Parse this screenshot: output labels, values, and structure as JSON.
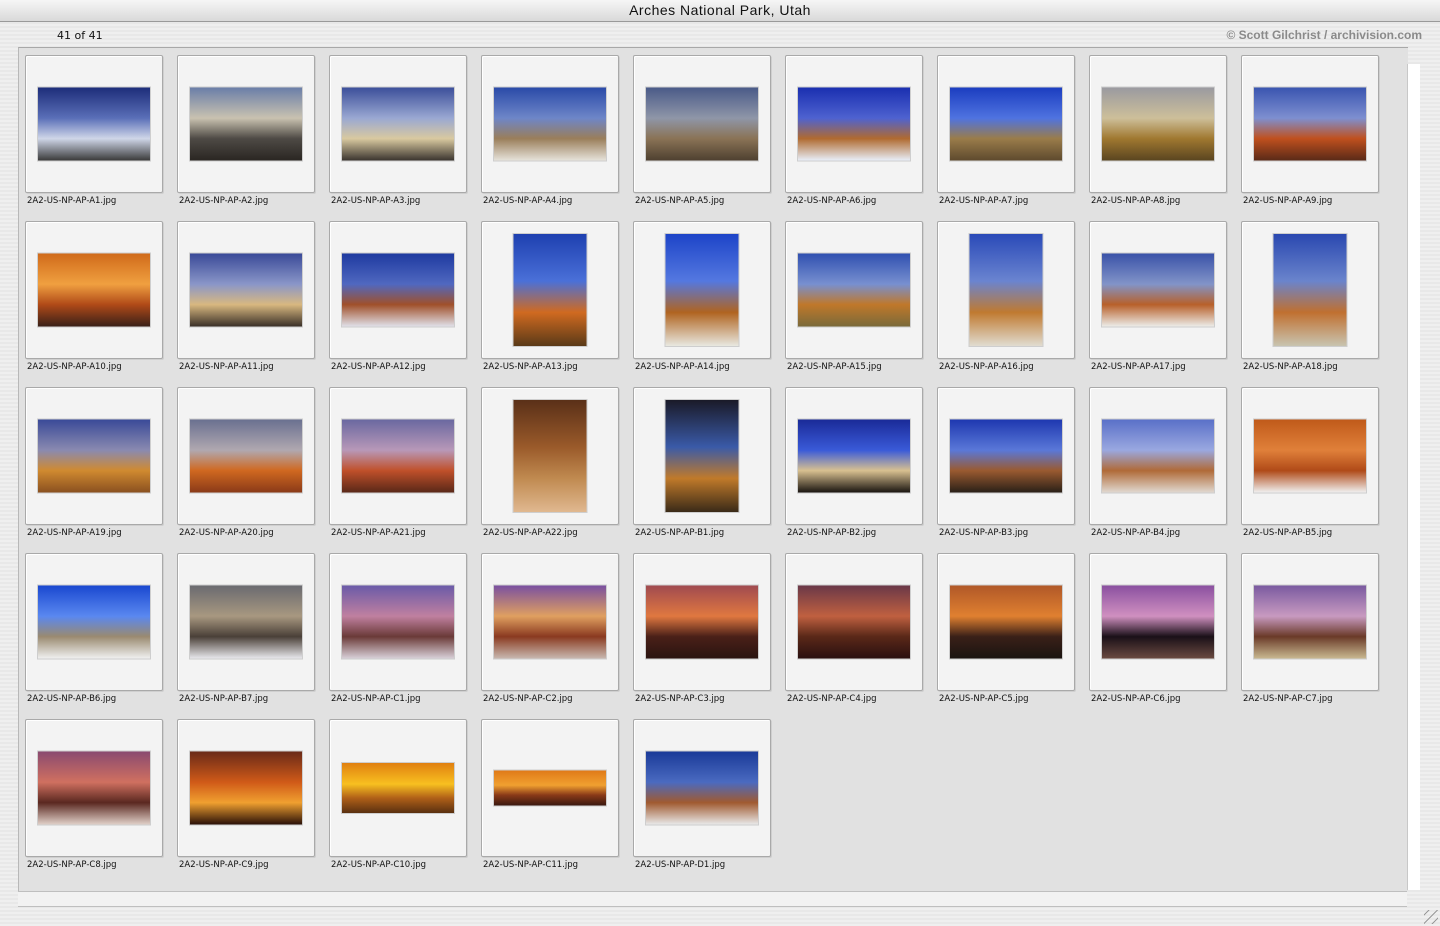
{
  "window": {
    "title": "Arches National Park, Utah",
    "count_label": "41 of 41",
    "copyright": "© Scott Gilchrist / archivision.com"
  },
  "thumbnails": [
    {
      "file": "2A2-US-NP-AP-A1.jpg",
      "orientation": "landscape",
      "palette": [
        "#1d2d7a",
        "#5a6fb8",
        "#cfd6e8",
        "#3a3a3a"
      ]
    },
    {
      "file": "2A2-US-NP-AP-A2.jpg",
      "orientation": "landscape",
      "palette": [
        "#6a7ea8",
        "#c9c2b0",
        "#4e4a45",
        "#2a2622"
      ]
    },
    {
      "file": "2A2-US-NP-AP-A3.jpg",
      "orientation": "landscape",
      "palette": [
        "#3c4f9a",
        "#9aa8d2",
        "#d9c9a0",
        "#3a342f"
      ]
    },
    {
      "file": "2A2-US-NP-AP-A4.jpg",
      "orientation": "landscape",
      "palette": [
        "#2a4aa8",
        "#6e86c8",
        "#9a7e5a",
        "#e6e2da"
      ]
    },
    {
      "file": "2A2-US-NP-AP-A5.jpg",
      "orientation": "landscape",
      "palette": [
        "#4a5a88",
        "#8f96a8",
        "#8a7356",
        "#4e4030"
      ]
    },
    {
      "file": "2A2-US-NP-AP-A6.jpg",
      "orientation": "landscape",
      "palette": [
        "#1a2fb0",
        "#4e62d0",
        "#b06a30",
        "#e8eef8"
      ]
    },
    {
      "file": "2A2-US-NP-AP-A7.jpg",
      "orientation": "landscape",
      "palette": [
        "#1b3dc0",
        "#4f73e0",
        "#9a7c4a",
        "#5e4a2e"
      ]
    },
    {
      "file": "2A2-US-NP-AP-A8.jpg",
      "orientation": "landscape",
      "palette": [
        "#9a9aa0",
        "#cdbf9a",
        "#a07830",
        "#5a4520"
      ]
    },
    {
      "file": "2A2-US-NP-AP-A9.jpg",
      "orientation": "landscape",
      "palette": [
        "#3a55b0",
        "#7e8fd0",
        "#c0501e",
        "#5a2a18"
      ]
    },
    {
      "file": "2A2-US-NP-AP-A10.jpg",
      "orientation": "landscape",
      "palette": [
        "#d06a1a",
        "#f0a040",
        "#b04a18",
        "#3a2018"
      ]
    },
    {
      "file": "2A2-US-NP-AP-A11.jpg",
      "orientation": "landscape",
      "palette": [
        "#3a4a98",
        "#8a96c8",
        "#d8b880",
        "#3a3028"
      ]
    },
    {
      "file": "2A2-US-NP-AP-A12.jpg",
      "orientation": "landscape",
      "palette": [
        "#1e3aa0",
        "#5068c0",
        "#a0502a",
        "#e0e0e8"
      ]
    },
    {
      "file": "2A2-US-NP-AP-A13.jpg",
      "orientation": "portrait",
      "palette": [
        "#1e40b0",
        "#4a70d8",
        "#d06a20",
        "#5a3a18"
      ]
    },
    {
      "file": "2A2-US-NP-AP-A14.jpg",
      "orientation": "portrait",
      "palette": [
        "#1d44c8",
        "#5478e0",
        "#b06420",
        "#e8e8e0"
      ]
    },
    {
      "file": "2A2-US-NP-AP-A15.jpg",
      "orientation": "landscape",
      "palette": [
        "#3050b0",
        "#7890d0",
        "#c0782a",
        "#7a6a3a"
      ]
    },
    {
      "file": "2A2-US-NP-AP-A16.jpg",
      "orientation": "portrait",
      "palette": [
        "#2a4ab8",
        "#6a84d0",
        "#c07a30",
        "#e0dcd0"
      ]
    },
    {
      "file": "2A2-US-NP-AP-A17.jpg",
      "orientation": "landscape",
      "palette": [
        "#3a52a8",
        "#8294c8",
        "#b8602a",
        "#ecece8"
      ]
    },
    {
      "file": "2A2-US-NP-AP-A18.jpg",
      "orientation": "portrait",
      "palette": [
        "#2a48b0",
        "#6a84cc",
        "#c07030",
        "#c8c4b0"
      ]
    },
    {
      "file": "2A2-US-NP-AP-A19.jpg",
      "orientation": "landscape",
      "palette": [
        "#3a4a98",
        "#8a8ab0",
        "#d08a30",
        "#8a5020"
      ]
    },
    {
      "file": "2A2-US-NP-AP-A20.jpg",
      "orientation": "landscape",
      "palette": [
        "#6a7090",
        "#b0a8b0",
        "#d06820",
        "#8a3a18"
      ]
    },
    {
      "file": "2A2-US-NP-AP-A21.jpg",
      "orientation": "landscape",
      "palette": [
        "#6a68a0",
        "#b898b8",
        "#c0502a",
        "#5a2818"
      ]
    },
    {
      "file": "2A2-US-NP-AP-A22.jpg",
      "orientation": "portrait",
      "palette": [
        "#5a3018",
        "#9a5a2a",
        "#c08a50",
        "#e0b890"
      ]
    },
    {
      "file": "2A2-US-NP-AP-B1.jpg",
      "orientation": "portrait",
      "palette": [
        "#1a1a28",
        "#3a5aa8",
        "#c07a2a",
        "#3a2a18"
      ]
    },
    {
      "file": "2A2-US-NP-AP-B2.jpg",
      "orientation": "landscape",
      "palette": [
        "#1a2a98",
        "#3a5ad8",
        "#d8c090",
        "#1a1410"
      ]
    },
    {
      "file": "2A2-US-NP-AP-B3.jpg",
      "orientation": "landscape",
      "palette": [
        "#1e38b0",
        "#5a78d8",
        "#9a5a30",
        "#2a2018"
      ]
    },
    {
      "file": "2A2-US-NP-AP-B4.jpg",
      "orientation": "landscape",
      "palette": [
        "#5a70c8",
        "#9aa8e0",
        "#b06a38",
        "#e0d8d0"
      ]
    },
    {
      "file": "2A2-US-NP-AP-B5.jpg",
      "orientation": "landscape",
      "palette": [
        "#c05a1a",
        "#e0803a",
        "#b04a18",
        "#f0f0f0"
      ]
    },
    {
      "file": "2A2-US-NP-AP-B6.jpg",
      "orientation": "landscape",
      "palette": [
        "#1a48d0",
        "#5a88f0",
        "#9a8a70",
        "#f0f0f0"
      ]
    },
    {
      "file": "2A2-US-NP-AP-B7.jpg",
      "orientation": "landscape",
      "palette": [
        "#6a6a70",
        "#a89880",
        "#4a4038",
        "#e8e8ec"
      ]
    },
    {
      "file": "2A2-US-NP-AP-C1.jpg",
      "orientation": "landscape",
      "palette": [
        "#6a5aa8",
        "#c080a0",
        "#6a3a38",
        "#d8d0d8"
      ]
    },
    {
      "file": "2A2-US-NP-AP-C2.jpg",
      "orientation": "landscape",
      "palette": [
        "#7a50a0",
        "#e0a060",
        "#8a3a20",
        "#c8b8b0"
      ]
    },
    {
      "file": "2A2-US-NP-AP-C3.jpg",
      "orientation": "landscape",
      "palette": [
        "#a04a50",
        "#e07840",
        "#4a2018",
        "#2a1410"
      ]
    },
    {
      "file": "2A2-US-NP-AP-C4.jpg",
      "orientation": "landscape",
      "palette": [
        "#6a3848",
        "#c06040",
        "#5a2818",
        "#2a1010"
      ]
    },
    {
      "file": "2A2-US-NP-AP-C5.jpg",
      "orientation": "landscape",
      "palette": [
        "#b05828",
        "#e08030",
        "#3a2018",
        "#1a1410"
      ]
    },
    {
      "file": "2A2-US-NP-AP-C6.jpg",
      "orientation": "landscape",
      "palette": [
        "#8a50a0",
        "#d090c0",
        "#1a1018",
        "#6a4a40"
      ]
    },
    {
      "file": "2A2-US-NP-AP-C7.jpg",
      "orientation": "landscape",
      "palette": [
        "#7a5aa0",
        "#c89ac0",
        "#6a3a28",
        "#c8b890"
      ]
    },
    {
      "file": "2A2-US-NP-AP-C8.jpg",
      "orientation": "landscape",
      "palette": [
        "#8a4a70",
        "#d07060",
        "#5a2820",
        "#e0d0c8"
      ]
    },
    {
      "file": "2A2-US-NP-AP-C9.jpg",
      "orientation": "landscape",
      "palette": [
        "#6a2a18",
        "#d05a18",
        "#f0a030",
        "#2a1008"
      ]
    },
    {
      "file": "2A2-US-NP-AP-C10.jpg",
      "orientation": "wide",
      "palette": [
        "#e08010",
        "#f8c020",
        "#b06018",
        "#5a3010"
      ]
    },
    {
      "file": "2A2-US-NP-AP-C11.jpg",
      "orientation": "panorama",
      "palette": [
        "#e07a18",
        "#f0a030",
        "#8a3a18",
        "#3a1810"
      ]
    },
    {
      "file": "2A2-US-NP-AP-D1.jpg",
      "orientation": "landscape",
      "palette": [
        "#1a3a98",
        "#4a6ac0",
        "#a05a30",
        "#e8e8e8"
      ]
    }
  ]
}
